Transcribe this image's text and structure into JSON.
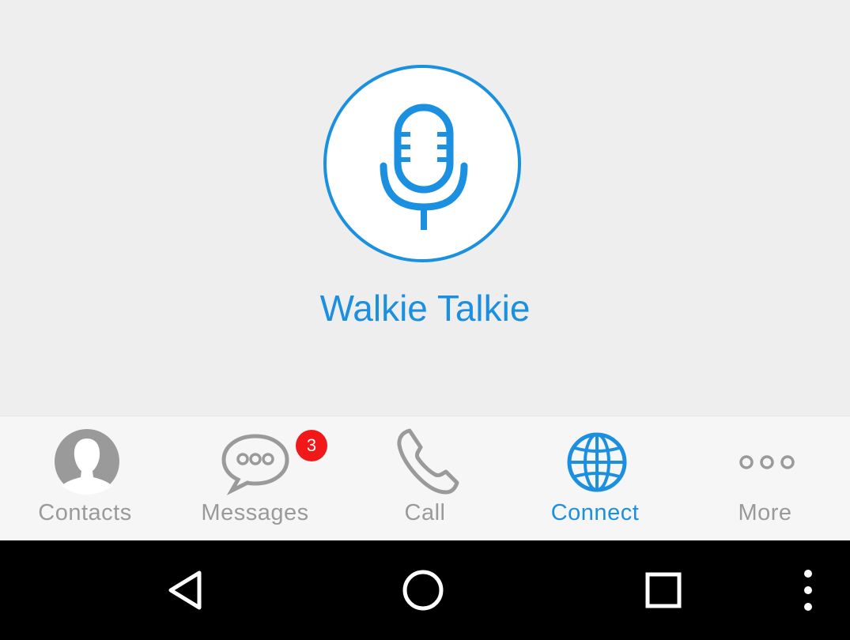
{
  "walkie_talkie": {
    "title": "Walkie Talkie",
    "icon": "microphone-icon"
  },
  "tabs": [
    {
      "label": "Contacts",
      "icon": "contact-person-icon",
      "active": false
    },
    {
      "label": "Messages",
      "icon": "speech-bubble-icon",
      "active": false,
      "badge": "3"
    },
    {
      "label": "Call",
      "icon": "phone-handset-icon",
      "active": false
    },
    {
      "label": "Connect",
      "icon": "globe-icon",
      "active": true
    },
    {
      "label": "More",
      "icon": "three-dots-icon",
      "active": false
    }
  ],
  "navigation_bar": {
    "buttons": [
      "back-icon",
      "home-icon",
      "recents-icon",
      "overflow-menu-icon"
    ]
  },
  "colors": {
    "accent": "#1b8fe0",
    "inactive": "#9a9a9a",
    "badge": "#f01818",
    "background": "#efeeee",
    "tabbar": "#f6f6f6",
    "navbar": "#000000"
  }
}
